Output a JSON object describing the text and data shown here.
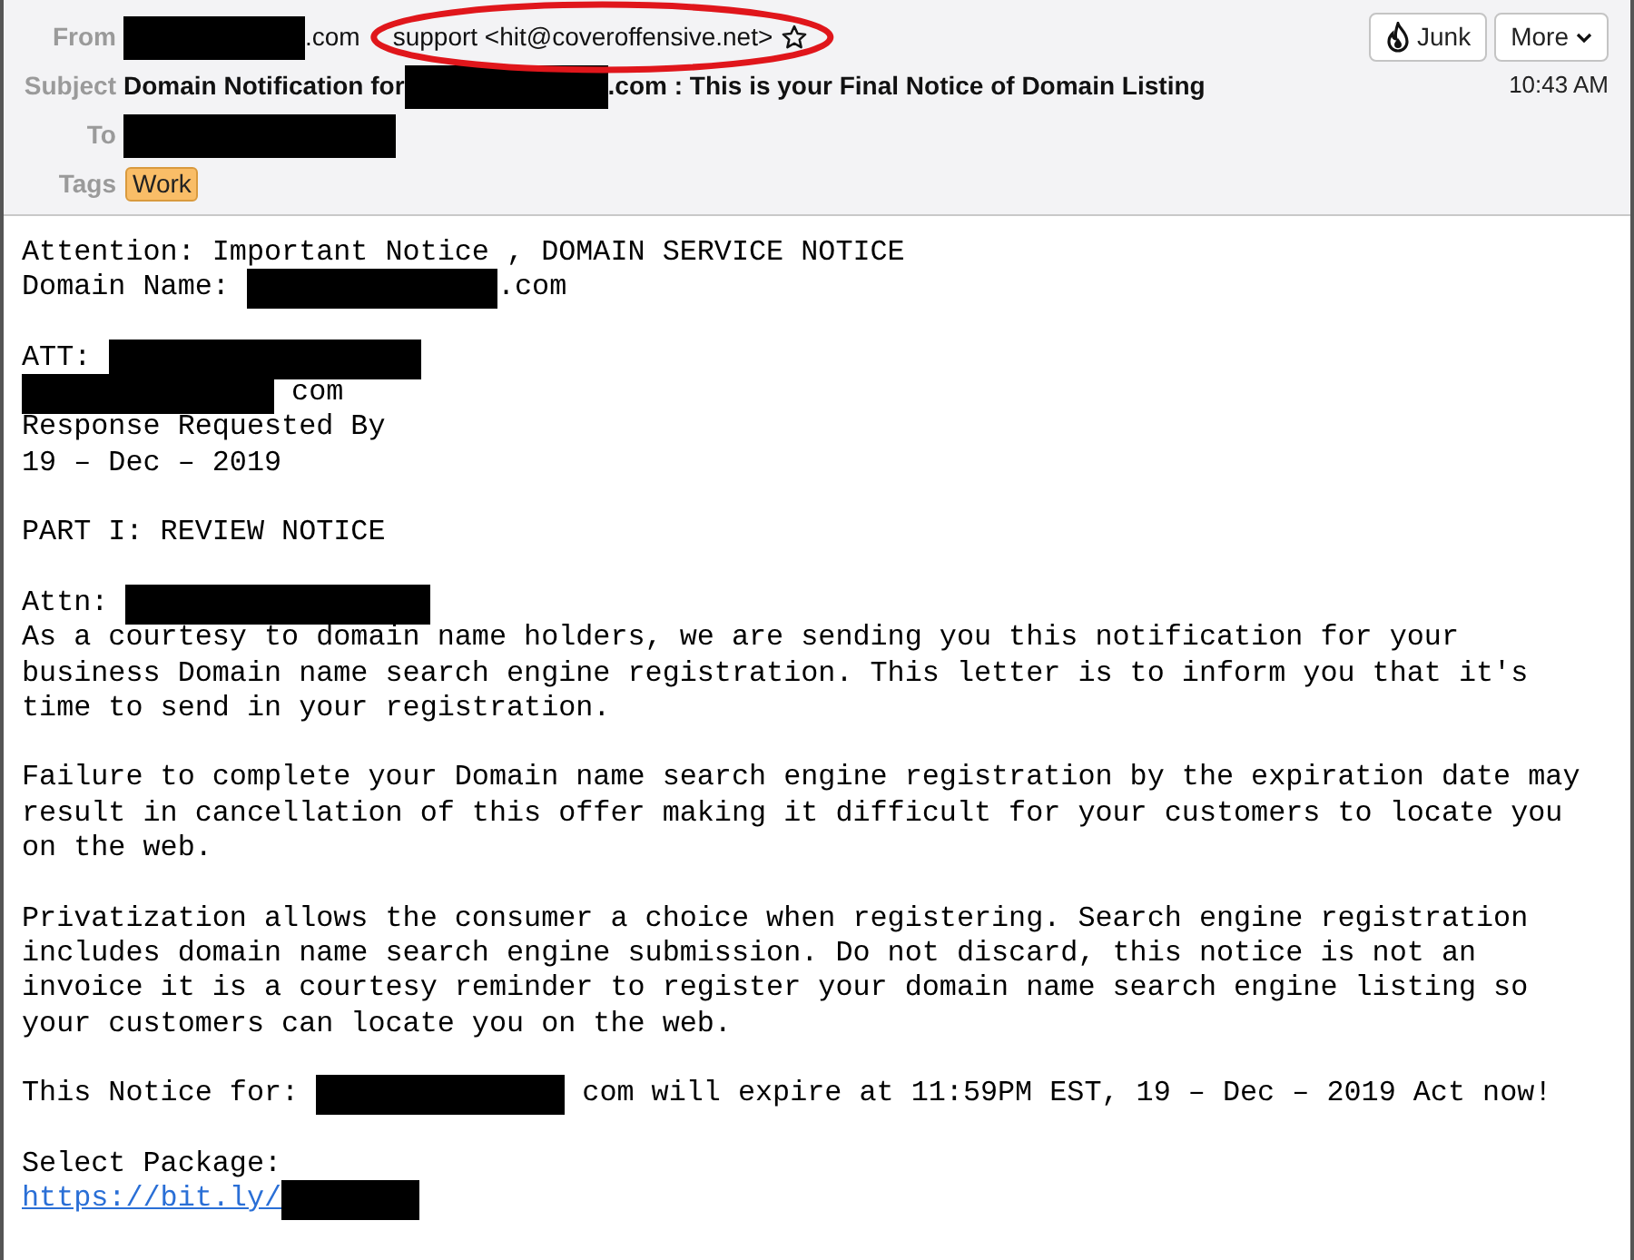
{
  "header": {
    "fields": [
      {
        "kind": "from",
        "label": "From",
        "segments": [
          {
            "kind": "redaction"
          },
          {
            "kind": "text",
            "text": ".com"
          },
          {
            "kind": "text",
            "text": "support <hit@coveroffensive.net>",
            "highlighted": true
          },
          {
            "kind": "star"
          }
        ]
      },
      {
        "kind": "subject",
        "label": "Subject",
        "segments": [
          {
            "kind": "text",
            "text": "Domain Notification for"
          },
          {
            "kind": "redaction"
          },
          {
            "kind": "text",
            "text": ".com : This is your Final Notice of Domain Listing"
          }
        ]
      },
      {
        "kind": "to",
        "label": "To",
        "segments": [
          {
            "kind": "redaction"
          }
        ]
      },
      {
        "kind": "tags",
        "label": "Tags",
        "segments": [
          {
            "kind": "tag",
            "text": "Work"
          }
        ]
      }
    ],
    "buttons": [
      {
        "kind": "junk",
        "label": "Junk"
      },
      {
        "kind": "more",
        "label": "More"
      }
    ],
    "time": "10:43 AM"
  },
  "body": {
    "blocks": [
      [
        [
          {
            "kind": "text",
            "text": "Attention: Important Notice , DOMAIN SERVICE NOTICE"
          }
        ],
        [
          {
            "kind": "text",
            "text": "Domain Name: "
          },
          {
            "kind": "redaction"
          },
          {
            "kind": "text",
            "text": ".com"
          }
        ]
      ],
      [
        [
          {
            "kind": "text",
            "text": "ATT: "
          },
          {
            "kind": "redaction"
          }
        ],
        [
          {
            "kind": "redaction"
          },
          {
            "kind": "text",
            "text": " com"
          }
        ],
        [
          {
            "kind": "text",
            "text": "Response Requested By"
          }
        ],
        [
          {
            "kind": "text",
            "text": "19 – Dec – 2019"
          }
        ]
      ],
      [
        [
          {
            "kind": "text",
            "text": "PART I: REVIEW NOTICE"
          }
        ]
      ],
      [
        [
          {
            "kind": "text",
            "text": "Attn: "
          },
          {
            "kind": "redaction"
          }
        ],
        [
          {
            "kind": "text",
            "text": "As a courtesy to domain name holders, we are sending you this notification for your"
          }
        ],
        [
          {
            "kind": "text",
            "text": "business Domain name search engine registration. This letter is to inform you that it's"
          }
        ],
        [
          {
            "kind": "text",
            "text": "time to send in your registration."
          }
        ]
      ],
      [
        [
          {
            "kind": "text",
            "text": "Failure to complete your Domain name search engine registration by the expiration date may"
          }
        ],
        [
          {
            "kind": "text",
            "text": "result in cancellation of this offer making it difficult for your customers to locate you"
          }
        ],
        [
          {
            "kind": "text",
            "text": "on the web."
          }
        ]
      ],
      [
        [
          {
            "kind": "text",
            "text": "Privatization allows the consumer a choice when registering. Search engine registration"
          }
        ],
        [
          {
            "kind": "text",
            "text": "includes domain name search engine submission. Do not discard, this notice is not an"
          }
        ],
        [
          {
            "kind": "text",
            "text": "invoice it is a courtesy reminder to register your domain name search engine listing so"
          }
        ],
        [
          {
            "kind": "text",
            "text": "your customers can locate you on the web."
          }
        ]
      ],
      [
        [
          {
            "kind": "text",
            "text": "This Notice for: "
          },
          {
            "kind": "redaction"
          },
          {
            "kind": "text",
            "text": " com will expire at 11:59PM EST, 19 – Dec – 2019 Act now!"
          }
        ]
      ],
      [
        [
          {
            "kind": "text",
            "text": "Select Package:"
          }
        ],
        [
          {
            "kind": "link",
            "text": "https://bit.ly/"
          },
          {
            "kind": "redaction"
          }
        ]
      ]
    ]
  }
}
